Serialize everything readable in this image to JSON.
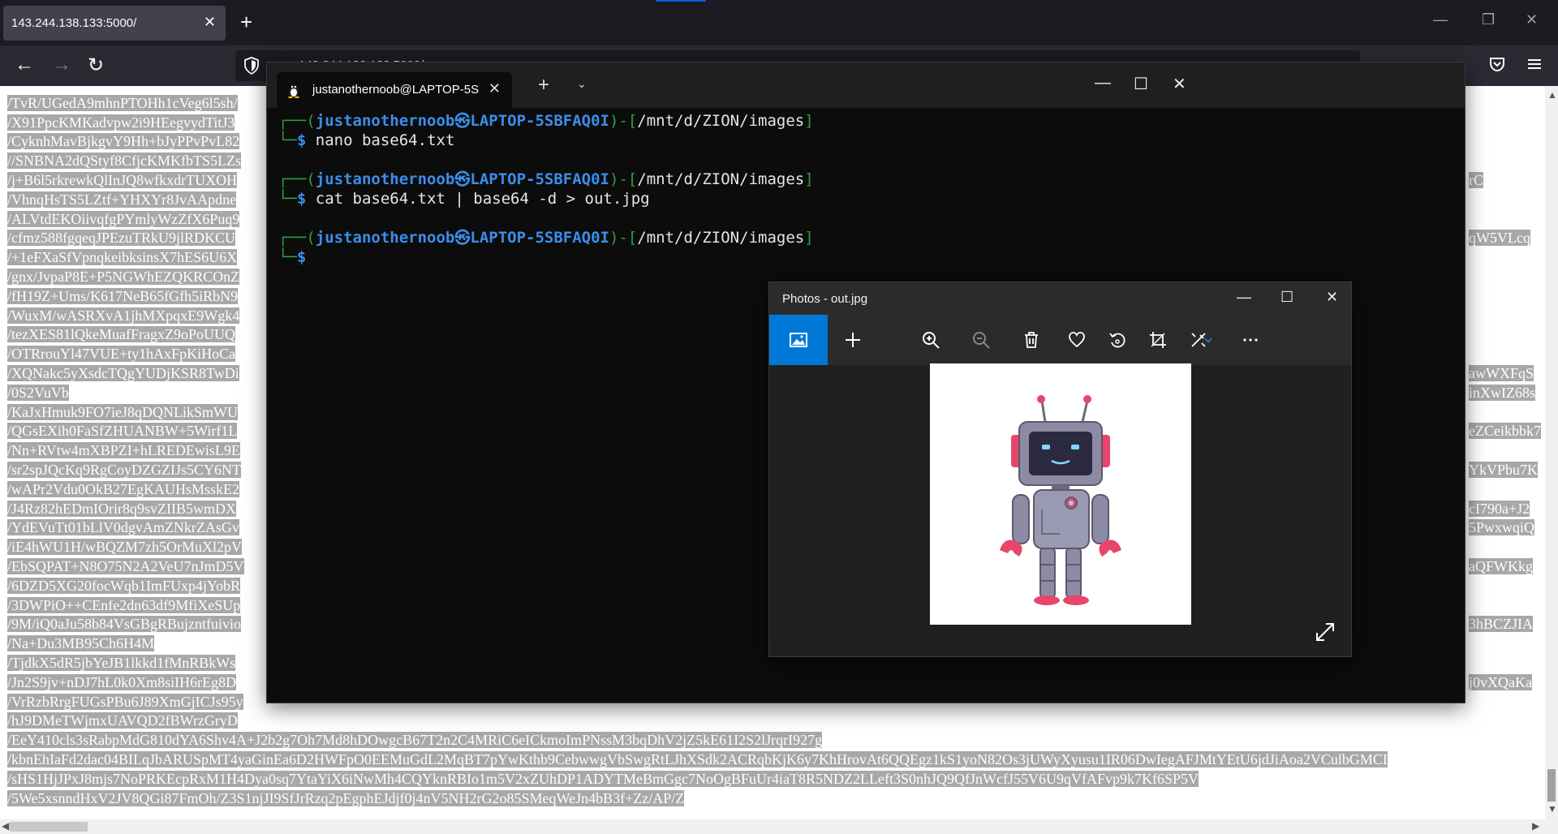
{
  "browser": {
    "tab_title": "143.244.138.133:5000/",
    "tab_close": "✕",
    "new_tab": "+",
    "url": "143.244.138.133:5000/",
    "minimize": "—",
    "restore": "❐",
    "close": "✕",
    "back": "←",
    "forward": "→",
    "reload": "↻"
  },
  "page_lines": [
    "/TvR/UGedA9mhnPTOHh1cVeg6l5sh/",
    "/X91PpcKMKadvpw2i9HEegvydTitJ3",
    "/CyknhMavBjkgvY9Hh+bJyPPvPvL82",
    "//SNBNA2dQStyf8CfjcKMKfbTS5LZs",
    "/j+B6l5rkrewkQlInJQ8wfkxdrTUXOH",
    "/VhnqHsTS5LZtf+YHXYr8JvAApdne",
    "/ALVtdEKOiivqfgPYmlyWzZfX6Puq9",
    "/cfmz588fgqeqJPEzuTRkU9jlRDKCU",
    "/+1eFXaSfVpnqkeibksinsX7hES6U6X",
    "/gnx/JvpaP8E+P5NGWhEZQKRCOnZ",
    "/fH19Z+Ums/K617NeB65fGfh5iRbN9",
    "/WuxM/wASRXvA1jhMXpqxE9Wgk4",
    "/tezXES81lQkeMuafFragxZ9oPoUUQ",
    "/OTRrouYl47VUE+ty1hAxFpKiHoCa",
    "/XQNakc5yXsdcTQgYUDjKSR8TwDi",
    "/0S2VuVb",
    "/KaJxHmuk9FO7ieJ8qDQNLikSmWU",
    "/QGsEXih0FaSfZHUANBW+5Wirf1L",
    "/Nn+RVtw4mXBPZI+hLREDEwisL9E",
    "/sr2spJQcKq9RgCoyDZGZIJs5CY6NT",
    "/wAPr2Vdu0OkB27EgKAUHsMsskE2",
    "/J4Rz82hEDmIOrir8q9svZIIB5wmDX",
    "/YdEVuTt01bLlV0dgvAmZNkrZAsGv",
    "/iE4hWU1H/wBQZM7zh5OrMuXl2pV",
    "/EbSQPAT+N8O75N2A2VeU7nJmD5V",
    "/6DZD5XG20focWqb1ImFUxp4jYobR",
    "/3DWPiO++CEnfe2dn63df9MfiXeSUp",
    "/9M/iQ0aJu58b84VsGBgRBujzntfuivio",
    "/Na+Du3MB95Ch6H4M",
    "/TjdkX5dR5jbYeJB1lkkd1fMnRBkWs",
    "/Jn2S9jv+nDJ7hL0k0Xm8siIH6rEg8D",
    "/VrRzbRrgFUGsPBu6J89XmGjICJs95y",
    "/hJ9DMeTWjmxUAVQD2fBWrzGryD",
    "/EeY410cls3sRabpMdG810dYA6Shv4A+J2b2g7Oh7Md8hDOwgcB67T2n2C4MRiC6eICkmoImPNssM3bqDhV2jZ5kE61I2S2lJrqrI927g",
    "/kbnEhIaFd2dac04BILqJbARUSpMT4yaGinEa6D2HWFpO0EEMuGdL2MqBT7pYwKthb9CebwwgVbSwgRtLJhXSdk2ACRqbKjK6y7KhHrovAt6QQEgz1kS1yoN82Os3jUWyXyusu1IR06DwIegAFJMtYEtU6jdJiAoa2VCulbGMCI",
    "/sHS1HjJPxJ8mjs7NoPRKEcpRxM1H4Dya0sq7YtaYiX6iNwMh4CQYknRBIo1m5V2xZUhDP1ADYTMeBmGgc7NoOgBFuUr4iaT8R5NDZ2LLeft3S0nhJQ9QfJnWcfJ55V6U9qVfAFvp9k7Kf6SP5V",
    "/5We5xsnndHxV2JV8QGi87FmOh/Z3S1njJI9SfJrRzq2pEgphEJdjf0j4nV5NH2rG2o85SMeqWeJn4bB3f+Zz/AP/Z"
  ],
  "page_right_fragments": [
    "rC",
    "qW5VLcq",
    "awWXFqS",
    "inXwIZ68s",
    "eZCeikbbk7",
    "YkVPbu7K",
    "cI790a+J2",
    "5PwxwqiQ",
    "aQFWKkg",
    "3hBCZJIA",
    "j0vXQaKa"
  ],
  "terminal": {
    "tab_title": "justanothernoob@LAPTOP-5S",
    "tab_close": "✕",
    "add_tab": "+",
    "dropdown": "⌄",
    "minimize": "—",
    "maximize": "☐",
    "close": "✕",
    "user": "justanothernoob",
    "at_symbol": "㉿",
    "host": "LAPTOP-5SBFAQ0I",
    "path": "/mnt/d/ZION/images",
    "prompt_top_prefix": "┌──(",
    "prompt_top_mid": ")-[",
    "prompt_top_end": "]",
    "prompt_bottom": "└─",
    "dollar": "$",
    "commands": [
      "nano base64.txt",
      "cat base64.txt | base64 -d > out.jpg",
      ""
    ]
  },
  "photos": {
    "title": "Photos - out.jpg",
    "minimize": "—",
    "maximize": "☐",
    "close": "✕",
    "accent": "#0078d7"
  }
}
